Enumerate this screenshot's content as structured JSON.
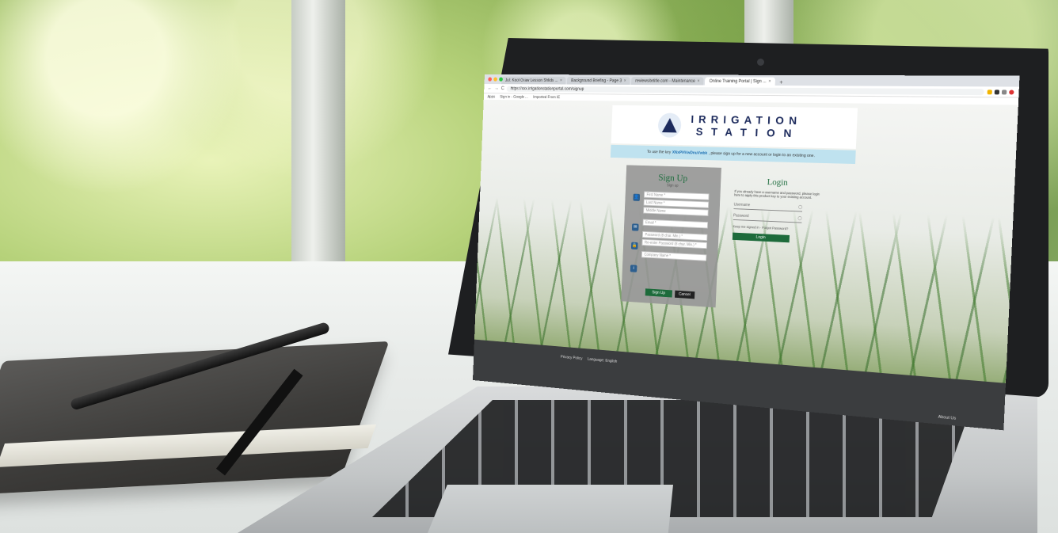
{
  "browser": {
    "tabs": [
      {
        "label": "Jul: Kool Graw Lesson Shlids ...",
        "active": false
      },
      {
        "label": "Background Briefing - Page 3",
        "active": false
      },
      {
        "label": "reviewsitetitle.com - Maintenance",
        "active": false
      },
      {
        "label": "Online Training Portal | Sign ...",
        "active": true
      }
    ],
    "url": "https://xxx.irrigationstationportal.com/signup",
    "bookmarks": [
      "Apps",
      "Sign in - Google ...",
      "Imported From IE"
    ]
  },
  "logo": {
    "line1": "IRRIGATION",
    "line2": "STATION"
  },
  "notice": {
    "prefix": "To use the key",
    "key": "XNxPHVwDnuVwbk",
    "suffix": ", please sign up for a new account or login to an existing one."
  },
  "signup": {
    "title": "Sign Up",
    "subtitle": "Sign up",
    "fields": [
      "First Name *",
      "Last Name *",
      "Middle Name",
      "Email *",
      "Password (8 char. Min.) *",
      "Re-enter Password (8 char. Min.) *",
      "Company Name *"
    ],
    "submit_label": "Sign Up",
    "cancel_label": "Cancel"
  },
  "login": {
    "title": "Login",
    "description": "If you already have a username and password, please login here to apply this product key to your existing account.",
    "username_placeholder": "Username",
    "password_placeholder": "Password",
    "remember_text": "Keep me signed in · Forgot Password?",
    "submit_label": "Login"
  },
  "footer": {
    "privacy": "Privacy Policy",
    "language": "Language: English",
    "about": "About Us"
  },
  "colors": {
    "brand_green": "#1d6b3b",
    "brand_navy": "#1c2a5c",
    "notice_bg": "#bfe2ef"
  }
}
